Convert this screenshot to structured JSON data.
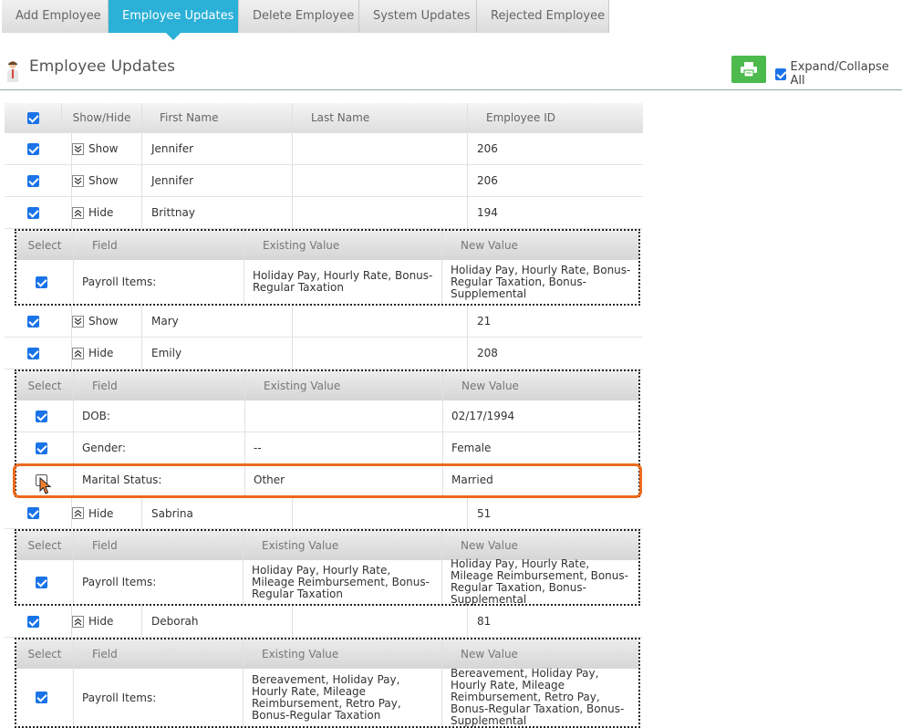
{
  "tabs": [
    "Add Employee",
    "Employee Updates",
    "Delete Employee",
    "System Updates",
    "Rejected Employee"
  ],
  "active_tab": "Employee Updates",
  "page_title": "Employee Updates",
  "expand_collapse_label": "Expand/Collapse All",
  "main_columns": [
    "Show/Hide",
    "First Name",
    "Last Name",
    "Employee ID"
  ],
  "detail_columns": [
    "Select",
    "Field",
    "Existing Value",
    "New Value"
  ],
  "employees": [
    {
      "toggle": "Show",
      "first_name": "Jennifer",
      "last_name": "",
      "employee_id": "206"
    },
    {
      "toggle": "Show",
      "first_name": "Jennifer",
      "last_name": "",
      "employee_id": "206"
    },
    {
      "toggle": "Hide",
      "first_name": "Brittnay",
      "last_name": "",
      "employee_id": "194",
      "details": [
        {
          "selected": true,
          "field": "Payroll Items:",
          "existing": "Holiday Pay, Hourly Rate, Bonus-Regular Taxation",
          "new": "Holiday Pay, Hourly Rate, Bonus-Regular Taxation, Bonus-Supplemental"
        }
      ]
    },
    {
      "toggle": "Show",
      "first_name": "Mary",
      "last_name": "",
      "employee_id": "21"
    },
    {
      "toggle": "Hide",
      "first_name": "Emily",
      "last_name": "",
      "employee_id": "208",
      "details": [
        {
          "selected": true,
          "field": "DOB:",
          "existing": "",
          "new": "02/17/1994"
        },
        {
          "selected": true,
          "field": "Gender:",
          "existing": "--",
          "new": "Female"
        },
        {
          "selected": false,
          "field": "Marital Status:",
          "existing": "Other",
          "new": "Married"
        }
      ]
    },
    {
      "toggle": "Hide",
      "first_name": "Sabrina",
      "last_name": "",
      "employee_id": "51",
      "details": [
        {
          "selected": true,
          "field": "Payroll Items:",
          "existing": "Holiday Pay, Hourly Rate, Mileage Reimbursement, Bonus-Regular Taxation",
          "new": "Holiday Pay, Hourly Rate, Mileage Reimbursement, Bonus-Regular Taxation, Bonus-Supplemental"
        }
      ]
    },
    {
      "toggle": "Hide",
      "first_name": "Deborah",
      "last_name": "",
      "employee_id": "81",
      "details": [
        {
          "selected": true,
          "field": "Payroll Items:",
          "existing": "Bereavement, Holiday Pay, Hourly Rate, Mileage Reimbursement, Retro Pay, Bonus-Regular Taxation",
          "new": "Bereavement, Holiday Pay, Hourly Rate, Mileage Reimbursement, Retro Pay, Bonus-Regular Taxation, Bonus-Supplemental"
        }
      ]
    }
  ],
  "colors": {
    "active_tab": "#2bb0d8",
    "print_button": "#4cba4c",
    "highlight": "#ec6a1c",
    "checkbox": "#1a73e8"
  }
}
